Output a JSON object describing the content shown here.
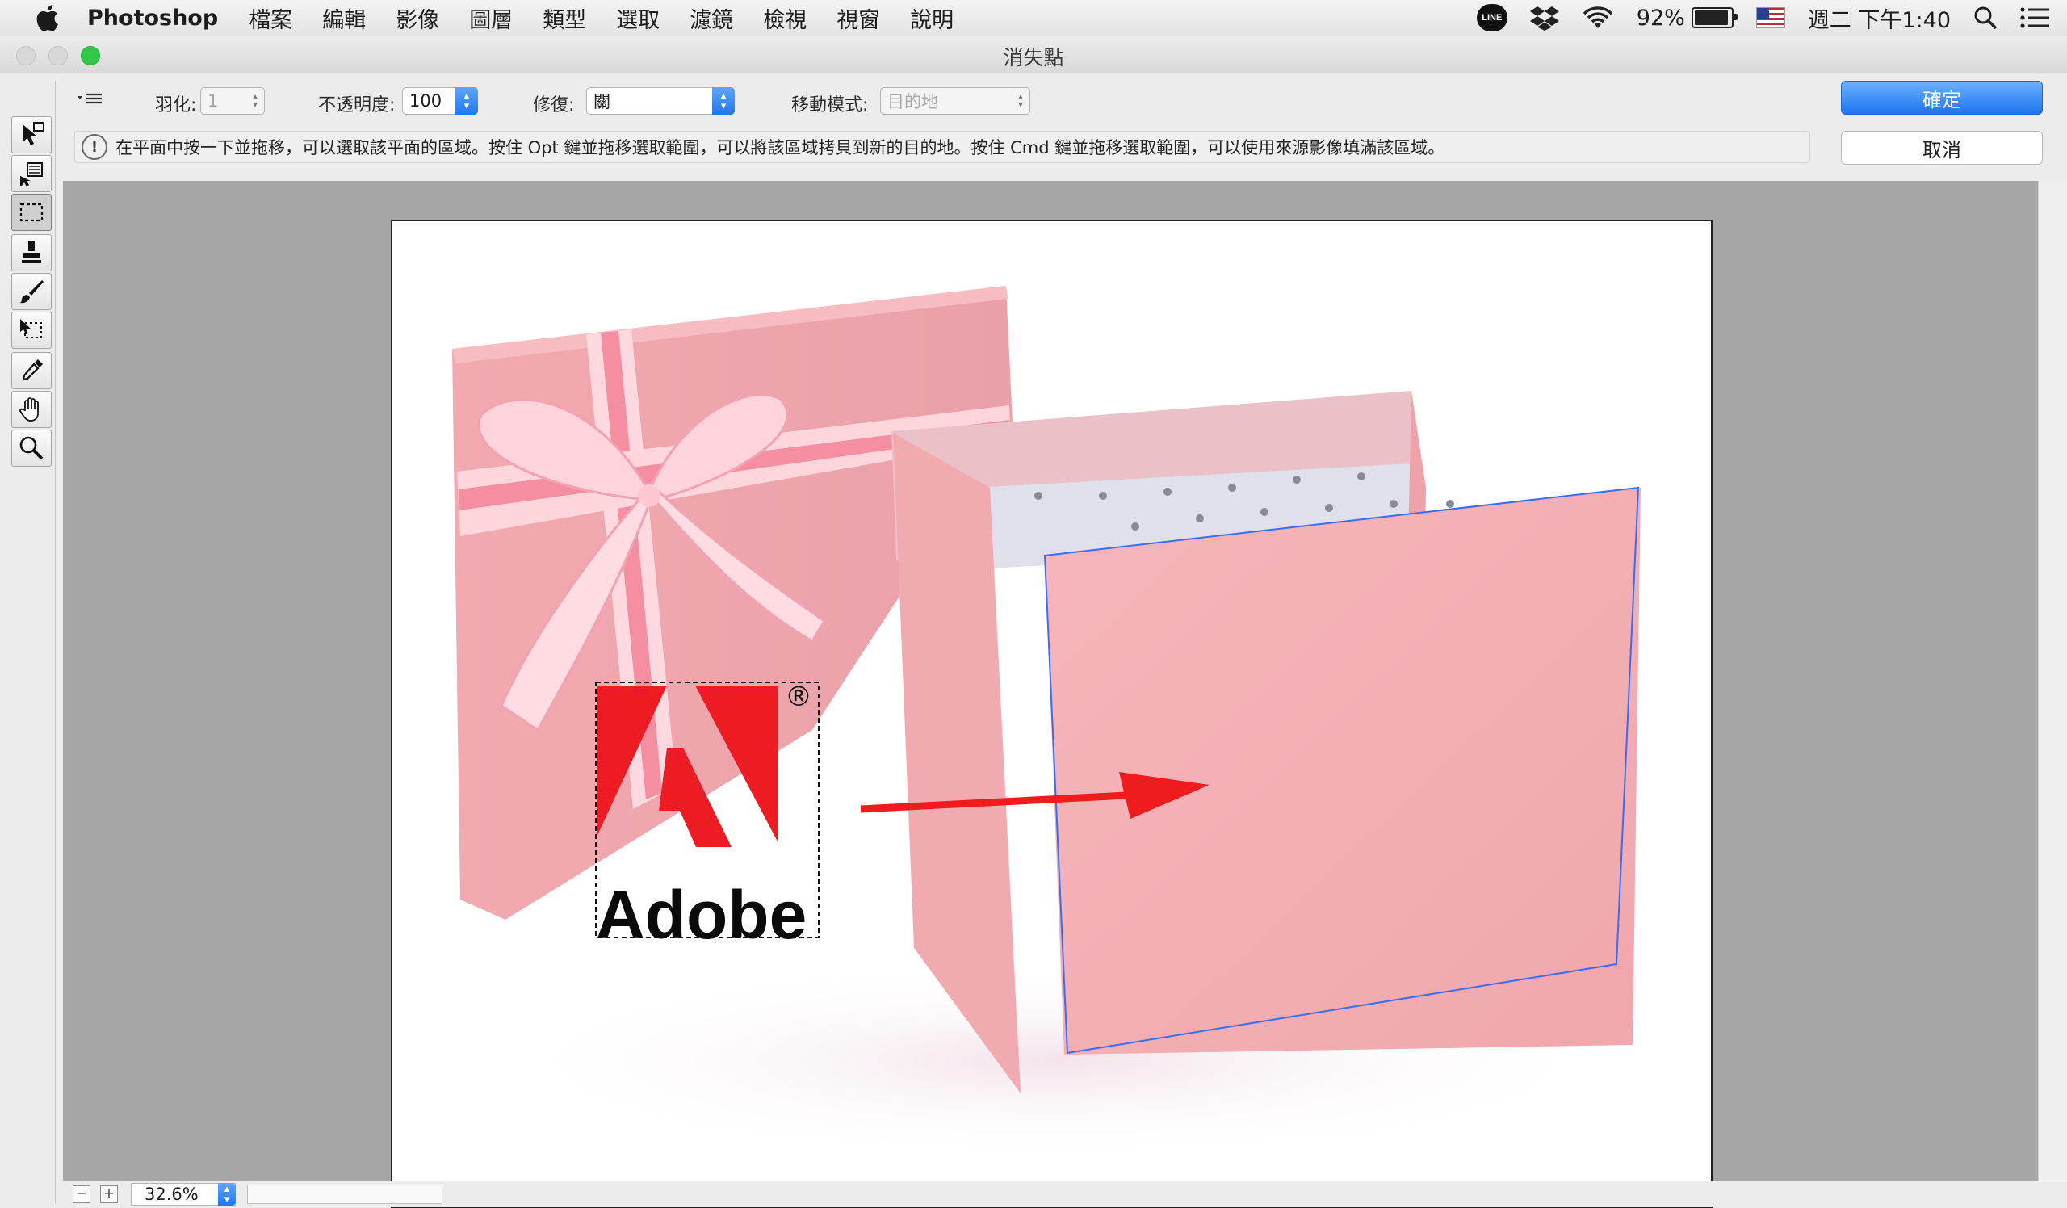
{
  "menubar": {
    "app_name": "Photoshop",
    "items": [
      "檔案",
      "編輯",
      "影像",
      "圖層",
      "類型",
      "選取",
      "濾鏡",
      "檢視",
      "視窗",
      "說明"
    ],
    "line_label": "LINE",
    "battery_percent": "92%",
    "clock": "週二 下午1:40"
  },
  "window": {
    "title": "消失點"
  },
  "options": {
    "feather_label": "羽化:",
    "feather_value": "1",
    "opacity_label": "不透明度:",
    "opacity_value": "100",
    "heal_label": "修復:",
    "heal_value": "關",
    "move_mode_label": "移動模式:",
    "move_mode_value": "目的地",
    "hint_text": "在平面中按一下並拖移，可以選取該平面的區域。按住 Opt 鍵並拖移選取範圍，可以將該區域拷貝到新的目的地。按住 Cmd 鍵並拖移選取範圍，可以使用來源影像填滿該區域。"
  },
  "buttons": {
    "ok": "確定",
    "cancel": "取消"
  },
  "tools": [
    "edit-plane-tool",
    "create-plane-tool",
    "marquee-tool",
    "stamp-tool",
    "brush-tool",
    "transform-tool",
    "eyedropper-tool",
    "hand-tool",
    "zoom-tool"
  ],
  "active_tool": "marquee-tool",
  "canvas": {
    "logo_text": "Adobe",
    "registered_mark": "®",
    "colors": {
      "box_pink": "#f2a8ae",
      "logo_red": "#ed1c24",
      "plane_grid": "#3a6df0",
      "arrow": "#ee1c1c"
    }
  },
  "statusbar": {
    "zoom_value": "32.6%"
  }
}
